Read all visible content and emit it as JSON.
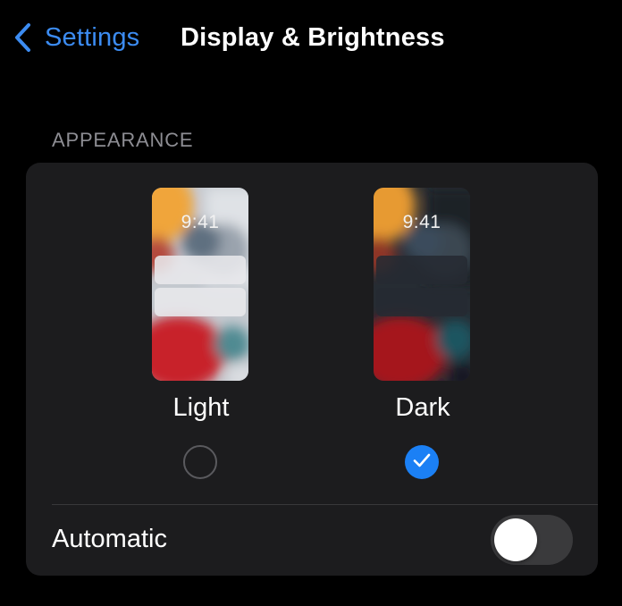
{
  "nav": {
    "back_label": "Settings",
    "title": "Display & Brightness"
  },
  "appearance": {
    "header": "APPEARANCE",
    "options": [
      {
        "label": "Light",
        "time": "9:41",
        "selected": false
      },
      {
        "label": "Dark",
        "time": "9:41",
        "selected": true
      }
    ],
    "automatic": {
      "label": "Automatic",
      "enabled": false
    }
  },
  "colors": {
    "accent": "#3c8cf2",
    "radio_selected": "#1b80f5",
    "background": "#000000",
    "card": "#1c1c1e",
    "header_text": "#8d8d93"
  },
  "icons": {
    "back": "chevron-left-icon",
    "selected": "checkmark-icon"
  }
}
